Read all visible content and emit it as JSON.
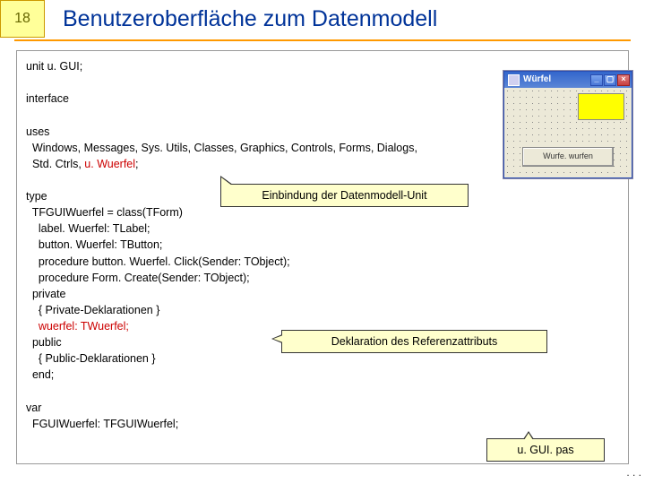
{
  "slide": {
    "number": "18",
    "title": "Benutzeroberfläche zum Datenmodell"
  },
  "code": {
    "l1": "unit u. GUI;",
    "l2": "interface",
    "l3": "uses",
    "l4": "  Windows, Messages, Sys. Utils, Classes, Graphics, Controls, Forms, Dialogs,",
    "l5a": "  Std. Ctrls, ",
    "l5b": "u. Wuerfel",
    "l5c": ";",
    "l6": "type",
    "l7": "  TFGUIWuerfel = class(TForm)",
    "l8": "    label. Wuerfel: TLabel;",
    "l9": "    button. Wuerfel: TButton;",
    "l10": "    procedure button. Wuerfel. Click(Sender: TObject);",
    "l11": "    procedure Form. Create(Sender: TObject);",
    "l12": "  private",
    "l13": "    { Private-Deklarationen }",
    "l14a": "    ",
    "l14b": "wuerfel: TWuerfel;",
    "l15": "  public",
    "l16": "    { Public-Deklarationen }",
    "l17": "  end;",
    "l18": "var",
    "l19": "  FGUIWuerfel: TFGUIWuerfel;"
  },
  "callouts": {
    "c1": "Einbindung der Datenmodell-Unit",
    "c2": "Deklaration des Referenzattributs",
    "c3": "u. GUI. pas"
  },
  "form": {
    "title": "Würfel",
    "button": "Wurfe. wurfen"
  },
  "ellipsis": ". . ."
}
